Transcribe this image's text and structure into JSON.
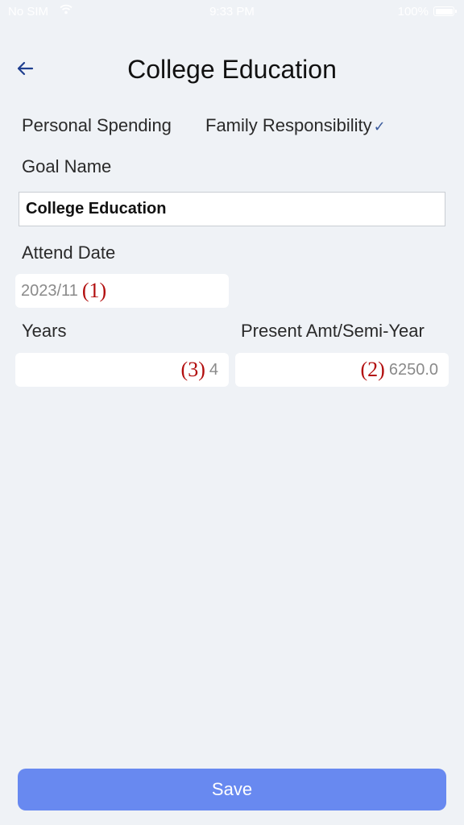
{
  "status_bar": {
    "carrier": "No SIM",
    "time": "9:33 PM",
    "battery": "100%"
  },
  "header": {
    "title": "College Education",
    "back_icon": "arrow-left-icon"
  },
  "tabs": [
    {
      "label": "Personal Spending",
      "selected": false
    },
    {
      "label": "Family Responsibility",
      "selected": true
    }
  ],
  "form": {
    "goal_name_label": "Goal Name",
    "goal_name_value": "College Education",
    "attend_date_label": "Attend Date",
    "attend_date_value": "2023/11",
    "attend_date_annotation": "(1)",
    "years_label": "Years",
    "years_value": "4",
    "years_annotation": "(3)",
    "amount_label": "Present Amt/Semi-Year",
    "amount_value": "6250.0",
    "amount_annotation": "(2)"
  },
  "save_label": "Save",
  "colors": {
    "background": "#eff2f6",
    "accent": "#6889f0",
    "annotation": "#b20e0e",
    "check": "#3a5a9c"
  }
}
